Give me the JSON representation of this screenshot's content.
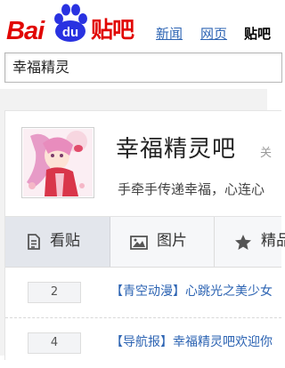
{
  "header": {
    "logo": {
      "latin": "Bai",
      "paw_text": "du",
      "cjk": "贴吧"
    },
    "nav": [
      {
        "label": "新闻",
        "current": false
      },
      {
        "label": "网页",
        "current": false
      },
      {
        "label": "贴吧",
        "current": true
      }
    ]
  },
  "search": {
    "value": "幸福精灵"
  },
  "forum": {
    "name": "幸福精灵吧",
    "follow_peek": "关",
    "slogan": "手牵手传递幸福，心连心"
  },
  "tabs": [
    {
      "label": "看贴",
      "icon": "document-icon",
      "active": true
    },
    {
      "label": "图片",
      "icon": "image-icon",
      "active": false
    },
    {
      "label": "精品",
      "icon": "star-icon",
      "active": false
    }
  ],
  "threads": [
    {
      "reply_count": "2",
      "title": "【青空动漫】心跳光之美少女"
    },
    {
      "reply_count": "4",
      "title": "【导航报】幸福精灵吧欢迎你"
    }
  ],
  "colors": {
    "brand_red": "#e10602",
    "paw_blue": "#2932e1",
    "link_blue": "#2d64b3"
  }
}
